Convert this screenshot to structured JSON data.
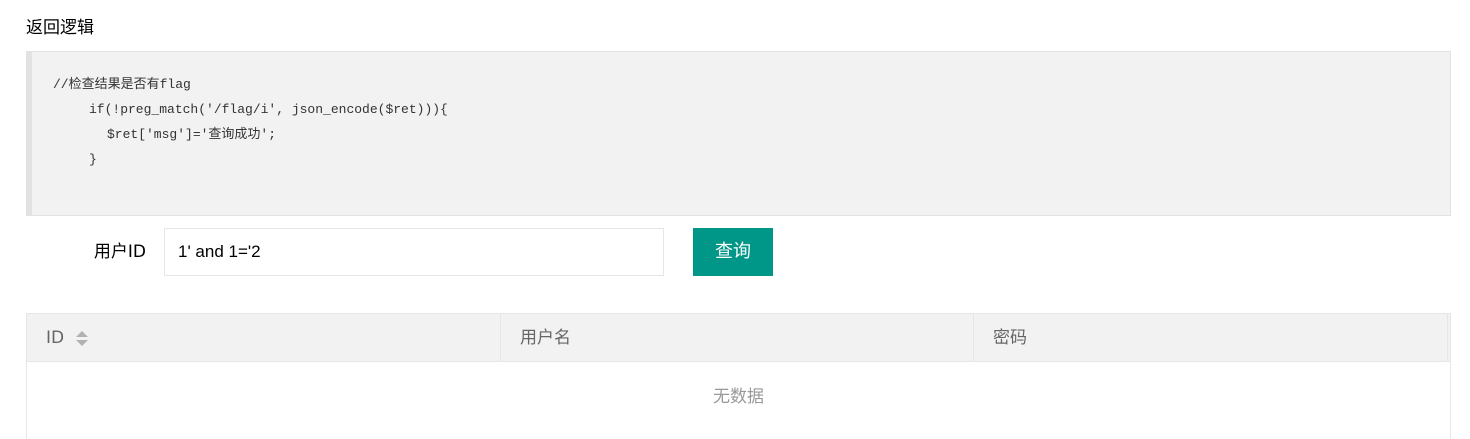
{
  "section": {
    "title": "返回逻辑"
  },
  "code": {
    "lines": [
      "//检查结果是否有flag",
      "if(!preg_match('/flag/i', json_encode($ret))){",
      "$ret['msg']='查询成功';",
      "}"
    ]
  },
  "form": {
    "label": "用户ID",
    "input_value": "1' and 1='2",
    "query_button": "查询"
  },
  "table": {
    "columns": [
      "ID",
      "用户名",
      "密码"
    ],
    "empty_text": "无数据"
  },
  "colors": {
    "accent": "#009688",
    "code_bg": "#f2f2f2",
    "header_bg": "#f2f2f2",
    "border": "#e6e6e6"
  },
  "icons": {
    "sort": "sort-icon"
  }
}
